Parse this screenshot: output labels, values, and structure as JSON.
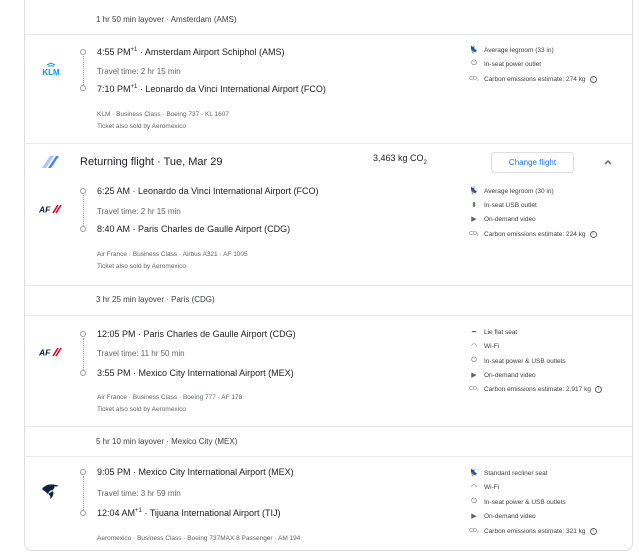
{
  "outbound": {
    "layover": "1 hr 50 min layover · Amsterdam (AMS)",
    "segment": {
      "airline_logo": "klm-logo",
      "logo_text": "KLM",
      "depart_time": "4:55 PM",
      "depart_sup": "+1",
      "depart_airport": "Amsterdam Airport Schiphol (AMS)",
      "travel_time": "Travel time: 2 hr 15 min",
      "arrive_time": "7:10 PM",
      "arrive_sup": "+1",
      "arrive_airport": "Leonardo da Vinci International Airport (FCO)",
      "details": "KLM · Business Class · Boeing 737 · KL 1607",
      "sold_by": "Ticket also sold by Aeromexico",
      "amenities": [
        {
          "icon": "seat-icon",
          "text": "Average legroom (33 in)"
        },
        {
          "icon": "power-icon",
          "text": "In-seat power outlet"
        },
        {
          "icon": "co2-icon",
          "text": "Carbon emissions estimate: 274 kg"
        }
      ]
    }
  },
  "returning": {
    "title": "Returning flight",
    "date": "Tue, Mar 29",
    "co2": "3,463 kg CO",
    "co2_sub": "2",
    "change_label": "Change flight",
    "segments": [
      {
        "logo_text": "AF",
        "depart_time": "6:25 AM",
        "depart_airport": "Leonardo da Vinci International Airport (FCO)",
        "travel_time": "Travel time: 2 hr 15 min",
        "arrive_time": "8:40 AM",
        "arrive_airport": "Paris Charles de Gaulle Airport (CDG)",
        "details": "Air France · Business Class · Airbus A321 · AF 1005",
        "sold_by": "Ticket also sold by Aeromexico",
        "amenities": [
          {
            "icon": "seat-icon",
            "text": "Average legroom (30 in)"
          },
          {
            "icon": "usb-icon",
            "text": "In-seat USB outlet"
          },
          {
            "icon": "video-icon",
            "text": "On-demand video"
          },
          {
            "icon": "co2-icon",
            "text": "Carbon emissions estimate: 224 kg"
          }
        ]
      },
      {
        "logo_text": "AF",
        "depart_time": "12:05 PM",
        "depart_airport": "Paris Charles de Gaulle Airport (CDG)",
        "travel_time": "Travel time: 11 hr 50 min",
        "arrive_time": "3:55 PM",
        "arrive_airport": "Mexico City International Airport (MEX)",
        "details": "Air France · Business Class · Boeing 777 · AF 178",
        "sold_by": "Ticket also sold by Aeromexico",
        "amenities": [
          {
            "icon": "flat-seat-icon",
            "text": "Lie flat seat"
          },
          {
            "icon": "wifi-icon",
            "text": "Wi-Fi"
          },
          {
            "icon": "power-icon",
            "text": "In-seat power & USB outlets"
          },
          {
            "icon": "video-icon",
            "text": "On-demand video"
          },
          {
            "icon": "co2-icon",
            "text": "Carbon emissions estimate: 2,917 kg"
          }
        ]
      },
      {
        "logo_text": "AM",
        "depart_time": "9:05 PM",
        "depart_airport": "Mexico City International Airport (MEX)",
        "travel_time": "Travel time: 3 hr 59 min",
        "arrive_time": "12:04 AM",
        "arrive_sup": "+1",
        "arrive_airport": "Tijuana International Airport (TIJ)",
        "details": "Aeromexico · Business Class · Boeing 737MAX 8 Passenger · AM 194",
        "amenities": [
          {
            "icon": "recliner-seat-icon",
            "text": "Standard recliner seat"
          },
          {
            "icon": "wifi-icon",
            "text": "Wi-Fi"
          },
          {
            "icon": "power-icon",
            "text": "In-seat power & USB outlets"
          },
          {
            "icon": "video-icon",
            "text": "On-demand video"
          },
          {
            "icon": "co2-icon",
            "text": "Carbon emissions estimate: 321 kg"
          }
        ]
      }
    ],
    "layovers": [
      "3 hr 25 min layover · Paris (CDG)",
      "5 hr 10 min layover · Mexico City (MEX)"
    ]
  },
  "colors": {
    "accent": "#1a73e8",
    "klm": "#00a1de",
    "airfrance_blue": "#002157",
    "airfrance_red": "#e4002b",
    "aeromexico": "#0b2343"
  }
}
